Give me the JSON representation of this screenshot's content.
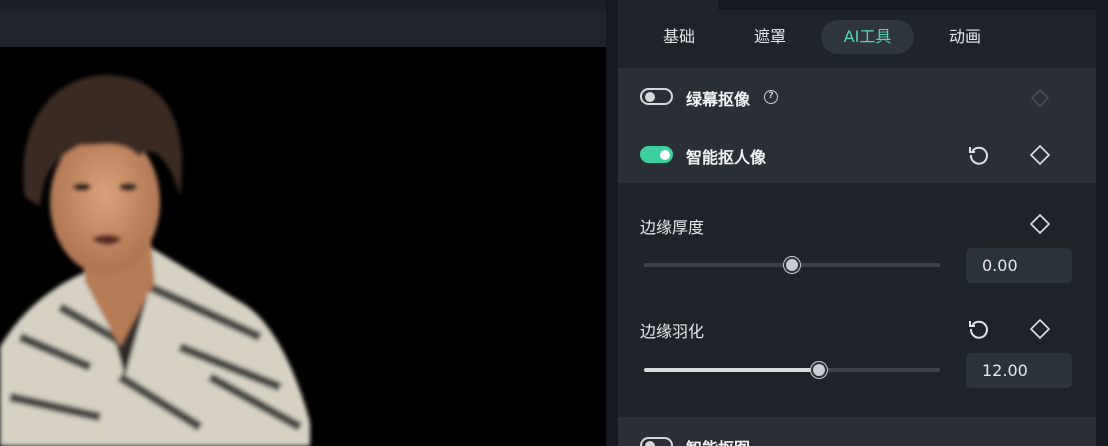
{
  "tabs": [
    {
      "label": "基础",
      "active": false
    },
    {
      "label": "遮罩",
      "active": false
    },
    {
      "label": "AI工具",
      "active": true
    },
    {
      "label": "动画",
      "active": false
    }
  ],
  "green_screen": {
    "label": "绿幕抠像",
    "enabled": false,
    "help_icon": "question-circle-icon"
  },
  "smart_cutout": {
    "label": "智能抠人像",
    "enabled": true
  },
  "params": {
    "edge_thickness": {
      "label": "边缘厚度",
      "value": "0.00",
      "level": 0.5
    },
    "edge_feather": {
      "label": "边缘羽化",
      "value": "12.00",
      "level": 0.59
    }
  },
  "next_section": {
    "label": "智能抠图",
    "enabled": false
  },
  "colors": {
    "accent": "#3ccf9f",
    "accent_text": "#4fd7b4",
    "panel": "#1e2329",
    "section": "#2a2f36"
  },
  "icons": {
    "reset": "reset-icon",
    "keyframe": "keyframe-diamond-icon"
  }
}
